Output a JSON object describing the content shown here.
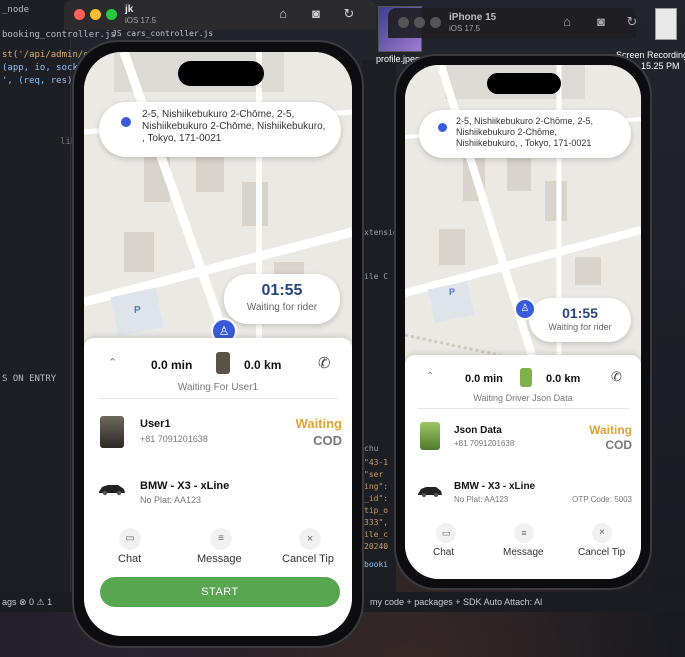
{
  "ide": {
    "left_lines": [
      "_node",
      "booking_controller.js",
      "st('/api/admin/edit_",
      "(app, io, socke",
      "', (req, res) =",
      "libr",
      "S ON ENTRY"
    ],
    "strip_lines": [
      "JS cars_controller.js",
      "xtensio",
      "ile C",
      "chu",
      "\"43-1",
      "\"ser",
      "ing\":",
      "_id\":",
      "tip_o",
      "333\",",
      "ile_c",
      "20240",
      "booki"
    ],
    "status_left": "ags ⊗ 0 ⚠ 1",
    "status_right": "my code + packages + SDK     Auto Attach: Al"
  },
  "desktop": {
    "file_label": "profile.jpeg",
    "recording_label_1": "Screen Recording",
    "recording_label_2": "0....15.25 PM"
  },
  "sim_left": {
    "name": "jk",
    "os": "iOS 17.5"
  },
  "sim_right": {
    "name": "iPhone 15",
    "os": "iOS 17.5"
  },
  "phone_left": {
    "address": "2-5, Nishiikebukuro 2-Chōme, 2-5, Nishiikebukuro 2-Chōme, Nishiikebukuro, , Tokyo, 171-0021",
    "timer": "01:55",
    "timer_status": "Waiting for rider",
    "parking": "P",
    "duration": "0.0 min",
    "distance": "0.0 km",
    "status_line": "Waiting For  User1",
    "user_name": "User1",
    "user_phone": "+81 7091201638",
    "ride_status": "Waiting",
    "payment": "COD",
    "car_name": "BMW - X3 - xLine",
    "plate": "No Plat: AA123",
    "actions": [
      "Chat",
      "Message",
      "Cancel Tip"
    ],
    "start_label": "START"
  },
  "phone_right": {
    "address": "2-5, Nishiikebukuro 2-Chōme, 2-5, Nishiikebukuro 2-Chōme, Nishiikebukuro, , Tokyo, 171-0021",
    "timer": "01:55",
    "timer_status": "Waiting for rider",
    "parking": "P",
    "duration": "0.0 min",
    "distance": "0.0 km",
    "status_line": "Waiting Driver Json Data",
    "user_name": "Json Data",
    "user_phone": "+81 7091201638",
    "ride_status": "Waiting",
    "payment": "COD",
    "car_name": "BMW - X3 - xLine",
    "plate": "No Plat: AA123",
    "otp": "OTP Code: 5003",
    "actions": [
      "Chat",
      "Message",
      "Cancel Tip"
    ]
  },
  "colors": {
    "accent_blue": "#3a5bd9",
    "waiting": "#e3a235",
    "start_green": "#58a64f",
    "timer_text": "#27467a"
  }
}
